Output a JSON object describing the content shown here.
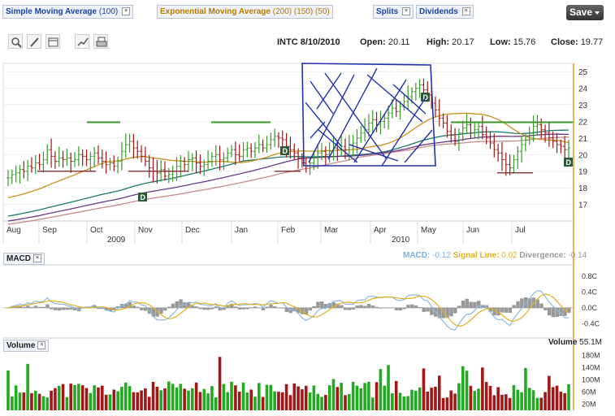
{
  "toolbar": {
    "indicators": [
      {
        "label": "Simple Moving Average",
        "params": "(100)",
        "color": "#1a44a8"
      },
      {
        "label": "Exponential Moving Average",
        "params": "(200) (150) (50)",
        "color": "#b77b00"
      },
      {
        "label": "Splits",
        "params": "",
        "color": "#1a44a8"
      },
      {
        "label": "Dividends",
        "params": "",
        "color": "#1a44a8"
      }
    ],
    "save_label": "Save"
  },
  "tool_icons": [
    "zoom-icon",
    "draw-icon",
    "calendar-icon",
    "chart-type-icon",
    "print-icon"
  ],
  "quote": {
    "symbol_date": "INTC 8/10/2010",
    "open_label": "Open:",
    "open": "20.11",
    "high_label": "High:",
    "high": "20.17",
    "low_label": "Low:",
    "low": "15.76",
    "close_label": "Close:",
    "close": "19.77"
  },
  "macd": {
    "panel_label": "MACD",
    "macd_label": "MACD:",
    "macd_value": "-0.12",
    "signal_label": "Signal Line:",
    "signal_value": "0.02",
    "divergence_label": "Divergence:",
    "divergence_value": "-0.14"
  },
  "volume": {
    "panel_label": "Volume",
    "legend_label": "Volume",
    "legend_value": "55.1M"
  },
  "chart_data": {
    "type": "line",
    "x_ticks": [
      "Aug",
      "Sep",
      "Oct",
      "Nov",
      "Dec",
      "Jan",
      "Feb",
      "Mar",
      "Apr",
      "May",
      "Jun",
      "Jul"
    ],
    "year_labels": [
      "2009",
      "2010"
    ],
    "price_ticks": [
      "25",
      "24",
      "23",
      "22",
      "21",
      "20",
      "19",
      "18",
      "17"
    ],
    "ylim": [
      16,
      25.5
    ],
    "price_close_approx": [
      18.6,
      18.8,
      18.9,
      19.1,
      19.0,
      19.3,
      19.2,
      19.5,
      19.4,
      19.7,
      20.3,
      19.9,
      19.6,
      19.8,
      19.7,
      19.8,
      19.6,
      19.7,
      20.0,
      19.9,
      19.7,
      19.9,
      20.1,
      19.8,
      19.6,
      19.4,
      19.5,
      19.3,
      19.6,
      20.2,
      20.6,
      20.8,
      20.4,
      20.2,
      19.9,
      19.6,
      19.2,
      19.0,
      18.9,
      19.1,
      18.7,
      18.8,
      19.0,
      19.3,
      19.6,
      19.4,
      19.7,
      19.8,
      19.5,
      19.3,
      19.4,
      19.6,
      19.9,
      20.0,
      19.7,
      19.8,
      20.1,
      20.3,
      20.0,
      19.9,
      20.3,
      20.4,
      20.2,
      20.4,
      20.6,
      20.4,
      20.6,
      20.9,
      21.1,
      21.0,
      20.9,
      20.5,
      20.3,
      20.1,
      19.8,
      19.5,
      19.3,
      19.5,
      19.8,
      20.1,
      20.2,
      20.0,
      20.2,
      20.4,
      20.3,
      20.5,
      20.3,
      20.6,
      20.7,
      21.0,
      21.3,
      21.5,
      21.9,
      22.1,
      21.8,
      22.0,
      22.2,
      22.5,
      22.8,
      22.6,
      22.9,
      23.2,
      23.5,
      23.8,
      24.0,
      24.2,
      23.9,
      23.6,
      23.1,
      22.7,
      22.2,
      21.9,
      21.4,
      21.2,
      20.8,
      21.3,
      21.6,
      21.8,
      21.3,
      21.5,
      21.7,
      21.2,
      21.0,
      20.7,
      20.3,
      20.1,
      19.7,
      19.4,
      19.2,
      19.7,
      20.2,
      20.6,
      20.9,
      21.3,
      21.7,
      21.8,
      21.5,
      21.3,
      21.0,
      20.8,
      20.6,
      20.5,
      20.3,
      20.4
    ],
    "series": [
      {
        "name": "SMA (100)",
        "color": "#1a7a6a"
      },
      {
        "name": "EMA (200)",
        "color": "#c58a8a"
      },
      {
        "name": "EMA (150)",
        "color": "#6a3a8a"
      },
      {
        "name": "EMA (50)",
        "color": "#c8901a"
      }
    ],
    "macd_ticks": [
      "0.8C",
      "0.4C",
      "0.0C",
      "-0.4C"
    ],
    "volume_ticks": [
      "180M",
      "140M",
      "100M",
      "60M",
      "20M"
    ],
    "dividend_markers": [
      "D",
      "D",
      "D",
      "D"
    ]
  }
}
